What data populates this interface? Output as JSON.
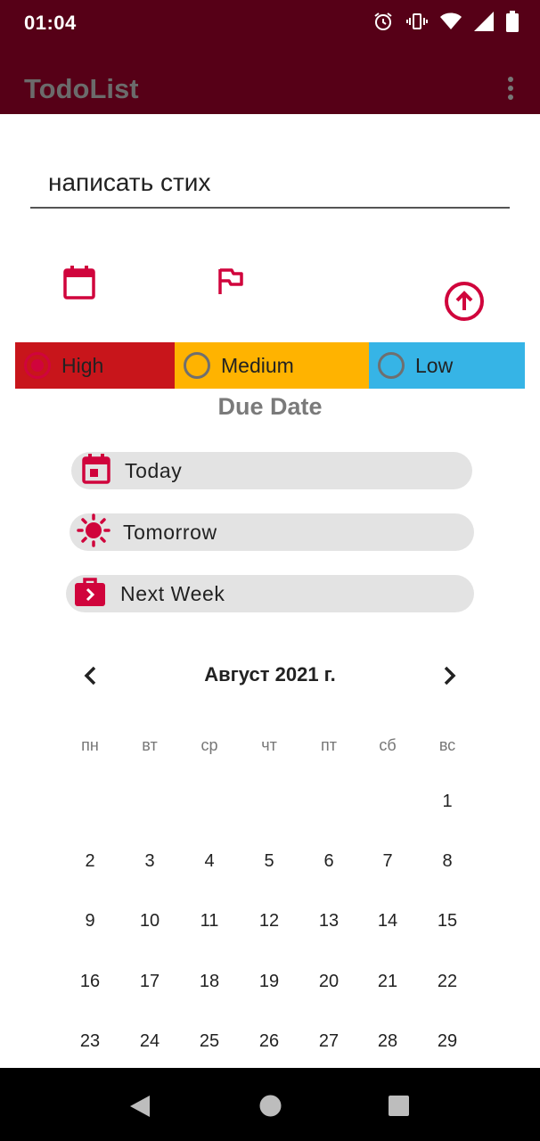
{
  "status_bar": {
    "time": "01:04"
  },
  "app_bar": {
    "title": "TodoList"
  },
  "task": {
    "input_value": "написать стих"
  },
  "priority": {
    "options": [
      {
        "label": "High",
        "color": "#c8151b",
        "selected": true
      },
      {
        "label": "Medium",
        "color": "#ffb300",
        "selected": false
      },
      {
        "label": "Low",
        "color": "#36b4e6",
        "selected": false
      }
    ]
  },
  "due_date": {
    "title": "Due Date",
    "chips": [
      {
        "label": "Today",
        "icon": "calendar-today-icon"
      },
      {
        "label": "Tomorrow",
        "icon": "sun-icon"
      },
      {
        "label": "Next Week",
        "icon": "briefcase-icon"
      }
    ]
  },
  "calendar": {
    "month_label": "Август 2021 г.",
    "weekdays": [
      "пн",
      "вт",
      "ср",
      "чт",
      "пт",
      "сб",
      "вс"
    ],
    "weeks": [
      [
        "",
        "",
        "",
        "",
        "",
        "",
        "1"
      ],
      [
        "2",
        "3",
        "4",
        "5",
        "6",
        "7",
        "8"
      ],
      [
        "9",
        "10",
        "11",
        "12",
        "13",
        "14",
        "15"
      ],
      [
        "16",
        "17",
        "18",
        "19",
        "20",
        "21",
        "22"
      ],
      [
        "23",
        "24",
        "25",
        "26",
        "27",
        "28",
        "29"
      ]
    ]
  },
  "colors": {
    "primary_dark": "#560017",
    "accent": "#d0043c",
    "chip_background": "#e3e3e3"
  }
}
